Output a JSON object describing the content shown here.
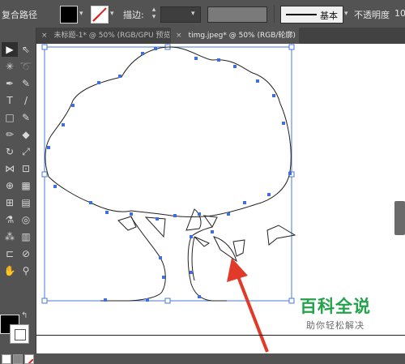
{
  "control_bar": {
    "object_type": "复合路径",
    "stroke_label": "描边:",
    "stroke_style_label": "基本",
    "opacity_label": "不透明度",
    "opacity_value_partial": "10",
    "fill_color": "#000000",
    "stroke_color": "#ffffff"
  },
  "tabs": [
    {
      "close": "×",
      "label": "未标题-1* @ 50% (RGB/GPU 预览)",
      "active": false
    },
    {
      "close": "×",
      "label": "timg.jpeg* @ 50% (RGB/轮廓)",
      "active": true
    }
  ],
  "toolbar": {
    "tools": [
      {
        "icon": "selection-tool-icon",
        "glyph": "▶"
      },
      {
        "icon": "direct-selection-tool-icon",
        "glyph": "⇖"
      },
      {
        "icon": "magic-wand-icon",
        "glyph": "✳"
      },
      {
        "icon": "lasso-icon",
        "glyph": "➰"
      },
      {
        "icon": "pen-tool-icon",
        "glyph": "✒"
      },
      {
        "icon": "curvature-tool-icon",
        "glyph": "✎"
      },
      {
        "icon": "type-tool-icon",
        "glyph": "T"
      },
      {
        "icon": "line-tool-icon",
        "glyph": "/"
      },
      {
        "icon": "rectangle-tool-icon",
        "glyph": "□"
      },
      {
        "icon": "brush-tool-icon",
        "glyph": "✎"
      },
      {
        "icon": "pencil-tool-icon",
        "glyph": "✏"
      },
      {
        "icon": "eraser-tool-icon",
        "glyph": "◆"
      },
      {
        "icon": "rotate-tool-icon",
        "glyph": "↻"
      },
      {
        "icon": "scale-tool-icon",
        "glyph": "⤢"
      },
      {
        "icon": "width-tool-icon",
        "glyph": "⋈"
      },
      {
        "icon": "free-transform-icon",
        "glyph": "⊡"
      },
      {
        "icon": "shape-builder-icon",
        "glyph": "⊕"
      },
      {
        "icon": "perspective-grid-icon",
        "glyph": "▦"
      },
      {
        "icon": "mesh-tool-icon",
        "glyph": "⊞"
      },
      {
        "icon": "gradient-tool-icon",
        "glyph": "▤"
      },
      {
        "icon": "eyedropper-icon",
        "glyph": "⚗"
      },
      {
        "icon": "blend-tool-icon",
        "glyph": "◎"
      },
      {
        "icon": "symbol-sprayer-icon",
        "glyph": "⁂"
      },
      {
        "icon": "column-graph-icon",
        "glyph": "▥"
      },
      {
        "icon": "artboard-tool-icon",
        "glyph": "⊏"
      },
      {
        "icon": "slice-tool-icon",
        "glyph": "⊘"
      },
      {
        "icon": "hand-tool-icon",
        "glyph": "✋"
      },
      {
        "icon": "zoom-tool-icon",
        "glyph": "⚲"
      }
    ]
  },
  "watermark": {
    "title": "百科全说",
    "subtitle": "助你轻松解决"
  }
}
